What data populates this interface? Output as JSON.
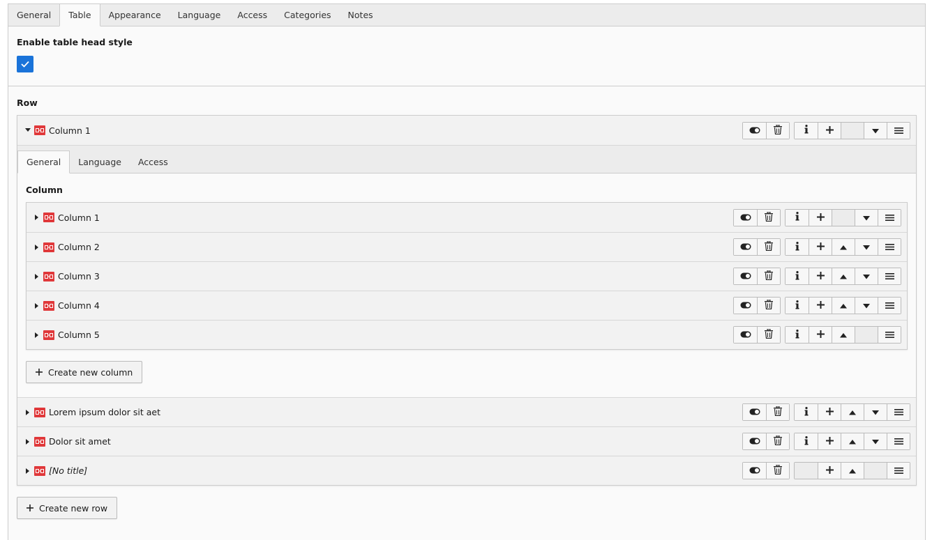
{
  "top_tabs": [
    "General",
    "Table",
    "Appearance",
    "Language",
    "Access",
    "Categories",
    "Notes"
  ],
  "active_top_tab": "Table",
  "head_style": {
    "label": "Enable table head style",
    "checked": true
  },
  "row_section_label": "Row",
  "expanded_row": {
    "title": "Column 1",
    "inner_tabs": [
      "General",
      "Language",
      "Access"
    ],
    "column_label": "Column",
    "columns": [
      "Column 1",
      "Column 2",
      "Column 3",
      "Column 4",
      "Column 5"
    ],
    "create_column_label": "Create new column"
  },
  "other_rows": [
    {
      "title": "Lorem ipsum dolor sit aet",
      "italic": false
    },
    {
      "title": "Dolor sit amet",
      "italic": false
    },
    {
      "title": "[No title]",
      "italic": true
    }
  ],
  "create_row_label": "Create new row",
  "colors": {
    "accent": "#1a73d9",
    "record_icon": "#e0383a"
  }
}
